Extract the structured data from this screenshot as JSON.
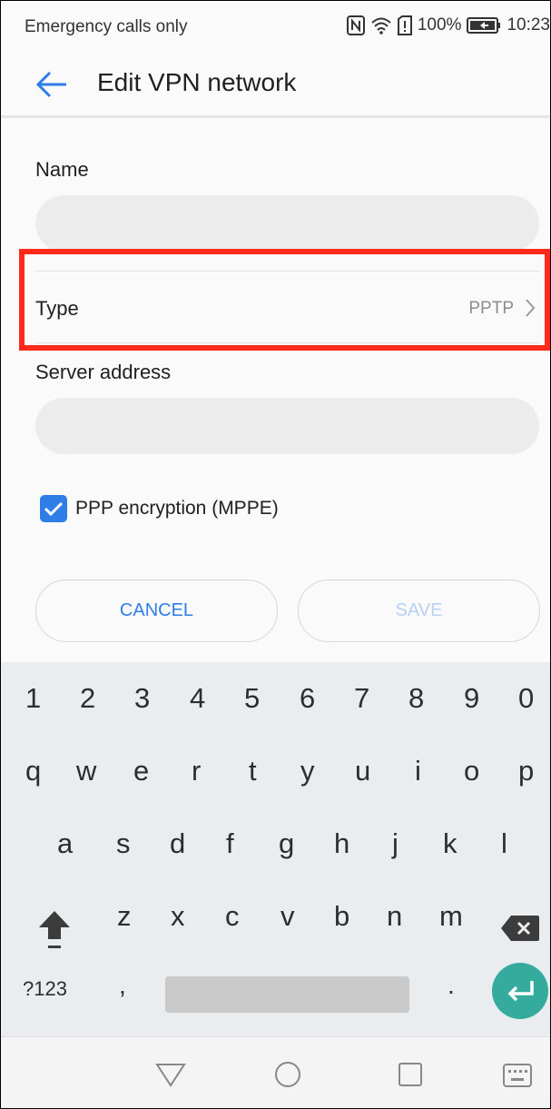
{
  "status_bar": {
    "carrier_text": "Emergency calls only",
    "battery_text": "100%",
    "time": "10:23",
    "icons": [
      "nfc-icon",
      "wifi-icon",
      "sim-alert-icon",
      "battery-icon"
    ]
  },
  "app_bar": {
    "title": "Edit VPN network",
    "back_icon": "back-arrow-icon"
  },
  "form": {
    "name_label": "Name",
    "name_value": "",
    "type_label": "Type",
    "type_value": "PPTP",
    "server_label": "Server address",
    "server_value": "",
    "encryption_label": "PPP encryption (MPPE)",
    "encryption_checked": true
  },
  "buttons": {
    "cancel": "CANCEL",
    "save": "SAVE"
  },
  "keyboard": {
    "numbers": [
      "1",
      "2",
      "3",
      "4",
      "5",
      "6",
      "7",
      "8",
      "9",
      "0"
    ],
    "row1": [
      "q",
      "w",
      "e",
      "r",
      "t",
      "y",
      "u",
      "i",
      "o",
      "p"
    ],
    "row2": [
      "a",
      "s",
      "d",
      "f",
      "g",
      "h",
      "j",
      "k",
      "l"
    ],
    "row3": [
      "z",
      "x",
      "c",
      "v",
      "b",
      "n",
      "m"
    ],
    "symbols_key": "?123",
    "comma_key": ",",
    "period_key": "."
  },
  "colors": {
    "accent": "#2f7ee8",
    "highlight": "#ff2a1a",
    "enter_key": "#34ab9c"
  }
}
